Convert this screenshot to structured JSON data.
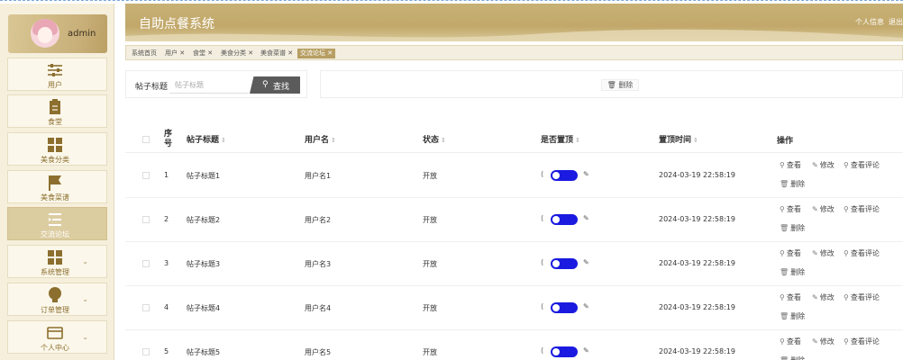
{
  "app": {
    "title": "自助点餐系统"
  },
  "header": {
    "links": [
      "个人信息",
      "退出"
    ]
  },
  "sidebar": {
    "user": "admin",
    "items": [
      {
        "label": "用户",
        "icon": "sliders-icon"
      },
      {
        "label": "食堂",
        "icon": "clipboard-icon"
      },
      {
        "label": "美食分类",
        "icon": "grid-icon"
      },
      {
        "label": "美食菜谱",
        "icon": "flag-icon"
      },
      {
        "label": "交流论坛",
        "icon": "list-icon",
        "active": true
      },
      {
        "label": "系统管理",
        "icon": "grid-icon",
        "expandable": true
      },
      {
        "label": "订单管理",
        "icon": "bulb-icon",
        "expandable": true
      },
      {
        "label": "个人中心",
        "icon": "card-icon",
        "expandable": true
      }
    ]
  },
  "tabs": [
    "系统首页",
    "用户 ✕",
    "食堂 ✕",
    "美食分类 ✕",
    "美食菜谱 ✕",
    "交流论坛 ✕"
  ],
  "search": {
    "label": "帖子标题",
    "placeholder": "帖子标题",
    "button": "查找"
  },
  "actions": {
    "delete": "删除"
  },
  "table": {
    "headers": {
      "index": "序号",
      "title": "帖子标题",
      "username": "用户名",
      "status": "状态",
      "pinned": "是否置顶",
      "pin_time": "置顶时间",
      "ops": "操作"
    },
    "op_labels": {
      "view": "查看",
      "edit": "修改",
      "comments": "查看评论",
      "delete": "删除"
    },
    "rows": [
      {
        "index": "1",
        "title": "帖子标题1",
        "username": "用户名1",
        "status": "开放",
        "pinned": true,
        "pin_time": "2024-03-19 22:58:19"
      },
      {
        "index": "2",
        "title": "帖子标题2",
        "username": "用户名2",
        "status": "开放",
        "pinned": true,
        "pin_time": "2024-03-19 22:58:19"
      },
      {
        "index": "3",
        "title": "帖子标题3",
        "username": "用户名3",
        "status": "开放",
        "pinned": true,
        "pin_time": "2024-03-19 22:58:19"
      },
      {
        "index": "4",
        "title": "帖子标题4",
        "username": "用户名4",
        "status": "开放",
        "pinned": true,
        "pin_time": "2024-03-19 22:58:19"
      },
      {
        "index": "5",
        "title": "帖子标题5",
        "username": "用户名5",
        "status": "开放",
        "pinned": true,
        "pin_time": "2024-03-19 22:58:19"
      }
    ]
  },
  "colors": {
    "accent": "#c2a86a",
    "toggle": "#1a1ae0",
    "sidebar_bg": "#f5efdc"
  }
}
